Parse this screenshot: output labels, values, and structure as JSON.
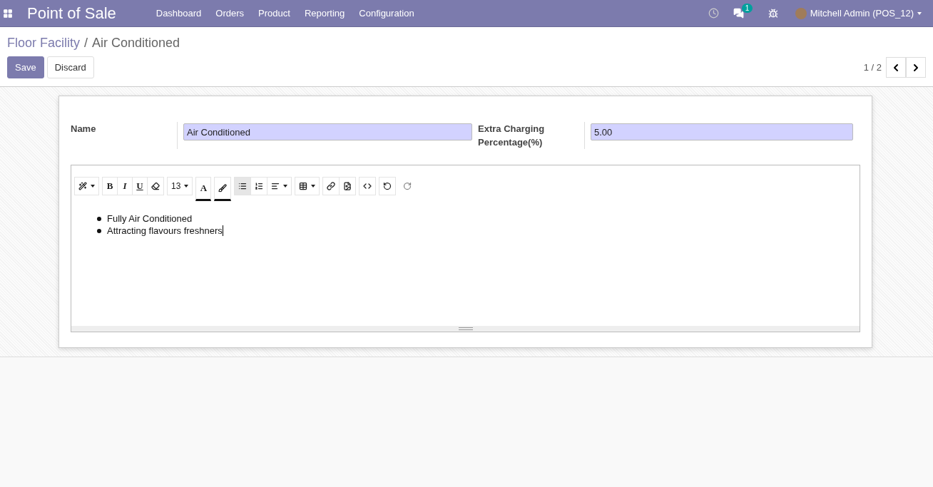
{
  "navbar": {
    "app_title": "Point of Sale",
    "menu": [
      "Dashboard",
      "Orders",
      "Product",
      "Reporting",
      "Configuration"
    ],
    "message_count": "1",
    "user": "Mitchell Admin (POS_12)"
  },
  "breadcrumb": {
    "parent": "Floor Facility",
    "separator": "/",
    "current": "Air Conditioned"
  },
  "buttons": [
    {
      "label": "Save",
      "kind": "primary"
    },
    {
      "label": "Discard",
      "kind": "secondary"
    }
  ],
  "pager": {
    "value": "1 / 2"
  },
  "form": {
    "fields": [
      {
        "label": "Name",
        "value": "Air Conditioned"
      },
      {
        "label": "Extra Charging Percentage(%)",
        "value": "5.00"
      }
    ],
    "editor": {
      "toolbar": [
        [
          {
            "kind": "wand",
            "caret": true,
            "selected": false
          }
        ],
        [
          {
            "kind": "bold",
            "label": "B",
            "caret": false,
            "selected": false
          },
          {
            "kind": "italic",
            "label": "I",
            "caret": false,
            "selected": false
          },
          {
            "kind": "underline",
            "label": "U",
            "caret": false,
            "selected": false
          },
          {
            "kind": "eraser",
            "caret": false,
            "selected": false
          }
        ],
        [
          {
            "kind": "size",
            "label": "13",
            "caret": true,
            "selected": false
          }
        ],
        [
          {
            "kind": "color",
            "label": "A",
            "caret": false,
            "selected": false
          }
        ],
        [
          {
            "kind": "brush",
            "caret": false,
            "selected": false
          }
        ],
        [
          {
            "kind": "bullets",
            "caret": false,
            "selected": true
          },
          {
            "kind": "numbers",
            "caret": false,
            "selected": false
          },
          {
            "kind": "align",
            "caret": true,
            "selected": false
          }
        ],
        [
          {
            "kind": "table",
            "caret": true,
            "selected": false
          }
        ],
        [
          {
            "kind": "link",
            "caret": false,
            "selected": false
          },
          {
            "kind": "image",
            "caret": false,
            "selected": false
          }
        ],
        [
          {
            "kind": "code",
            "caret": false,
            "selected": false
          }
        ],
        [
          {
            "kind": "undo",
            "caret": false,
            "selected": false
          }
        ],
        [
          {
            "kind": "redo",
            "caret": false,
            "selected": false,
            "disabled": true
          }
        ]
      ],
      "bullets": [
        "Fully Air Conditioned",
        "Attracting flavours freshners"
      ]
    }
  }
}
